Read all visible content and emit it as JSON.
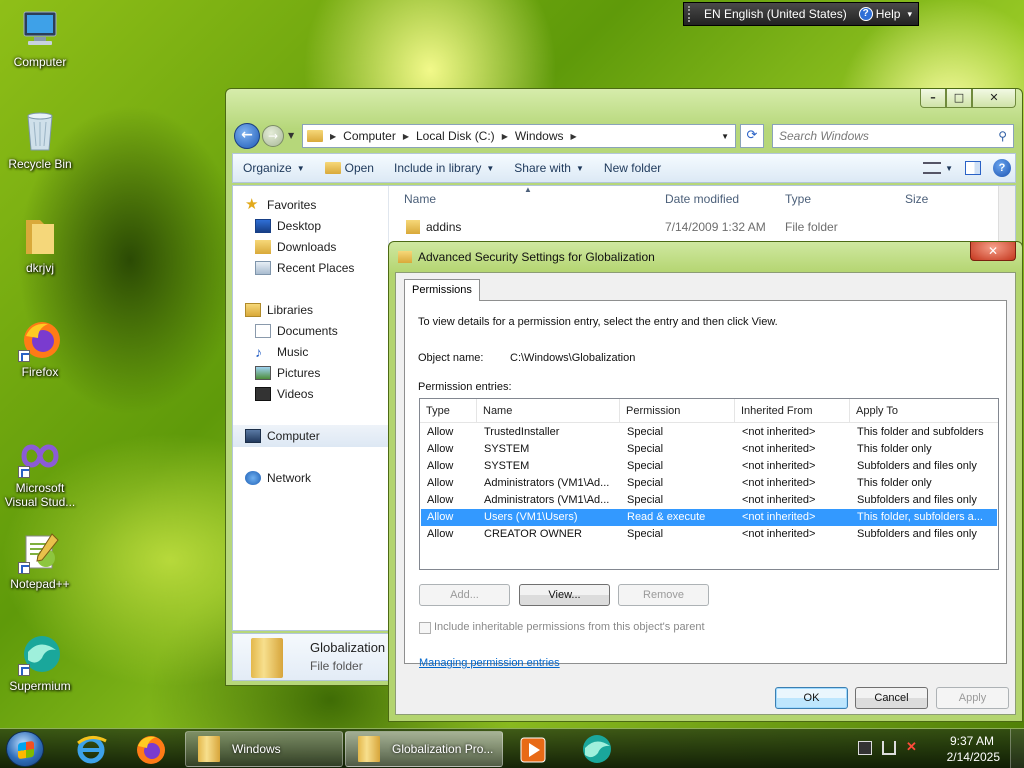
{
  "desktop": {
    "icons": [
      {
        "label": "Computer"
      },
      {
        "label": "Recycle Bin"
      },
      {
        "label": "dkrjvj"
      },
      {
        "label": "Firefox"
      },
      {
        "label": "Microsoft Visual Stud..."
      },
      {
        "label": "Notepad++"
      },
      {
        "label": "Supermium"
      }
    ]
  },
  "language_bar": {
    "language": "EN English (United States)",
    "help": "Help"
  },
  "explorer": {
    "address": [
      "Computer",
      "Local Disk (C:)",
      "Windows"
    ],
    "search_placeholder": "Search Windows",
    "toolbar": {
      "organize": "Organize",
      "open": "Open",
      "include_in_library": "Include in library",
      "share_with": "Share with",
      "new_folder": "New folder"
    },
    "nav": {
      "favorites": "Favorites",
      "desktop": "Desktop",
      "downloads": "Downloads",
      "recent_places": "Recent Places",
      "libraries": "Libraries",
      "documents": "Documents",
      "music": "Music",
      "pictures": "Pictures",
      "videos": "Videos",
      "computer": "Computer",
      "network": "Network"
    },
    "columns": {
      "name": "Name",
      "date_modified": "Date modified",
      "type": "Type",
      "size": "Size"
    },
    "rows": [
      {
        "name": "addins",
        "date": "7/14/2009 1:32 AM",
        "type": "File folder"
      }
    ],
    "details": {
      "name": "Globalization",
      "type": "File folder"
    }
  },
  "dialog": {
    "title": "Advanced Security Settings for Globalization",
    "tab": "Permissions",
    "instructions": "To view details for a permission entry, select the entry and then click View.",
    "object_name_label": "Object name:",
    "object_name_value": "C:\\Windows\\Globalization",
    "entries_label": "Permission entries:",
    "columns": {
      "type": "Type",
      "name": "Name",
      "permission": "Permission",
      "inherited_from": "Inherited From",
      "apply_to": "Apply To"
    },
    "entries": [
      {
        "type": "Allow",
        "name": "TrustedInstaller",
        "permission": "Special",
        "inherited": "<not inherited>",
        "apply": "This folder and subfolders"
      },
      {
        "type": "Allow",
        "name": "SYSTEM",
        "permission": "Special",
        "inherited": "<not inherited>",
        "apply": "This folder only"
      },
      {
        "type": "Allow",
        "name": "SYSTEM",
        "permission": "Special",
        "inherited": "<not inherited>",
        "apply": "Subfolders and files only"
      },
      {
        "type": "Allow",
        "name": "Administrators (VM1\\Ad...",
        "permission": "Special",
        "inherited": "<not inherited>",
        "apply": "This folder only"
      },
      {
        "type": "Allow",
        "name": "Administrators (VM1\\Ad...",
        "permission": "Special",
        "inherited": "<not inherited>",
        "apply": "Subfolders and files only"
      },
      {
        "type": "Allow",
        "name": "Users (VM1\\Users)",
        "permission": "Read & execute",
        "inherited": "<not inherited>",
        "apply": "This folder, subfolders a..."
      },
      {
        "type": "Allow",
        "name": "CREATOR OWNER",
        "permission": "Special",
        "inherited": "<not inherited>",
        "apply": "Subfolders and files only"
      }
    ],
    "selected_entry": 5,
    "buttons": {
      "add": "Add...",
      "view": "View...",
      "remove": "Remove",
      "ok": "OK",
      "cancel": "Cancel",
      "apply": "Apply"
    },
    "checkbox_label": "Include inheritable permissions from this object's parent",
    "link": "Managing permission entries"
  },
  "taskbar": {
    "windows_label": "Windows",
    "globalization_label": "Globalization Pro...",
    "time": "9:37 AM",
    "date": "2/14/2025"
  }
}
